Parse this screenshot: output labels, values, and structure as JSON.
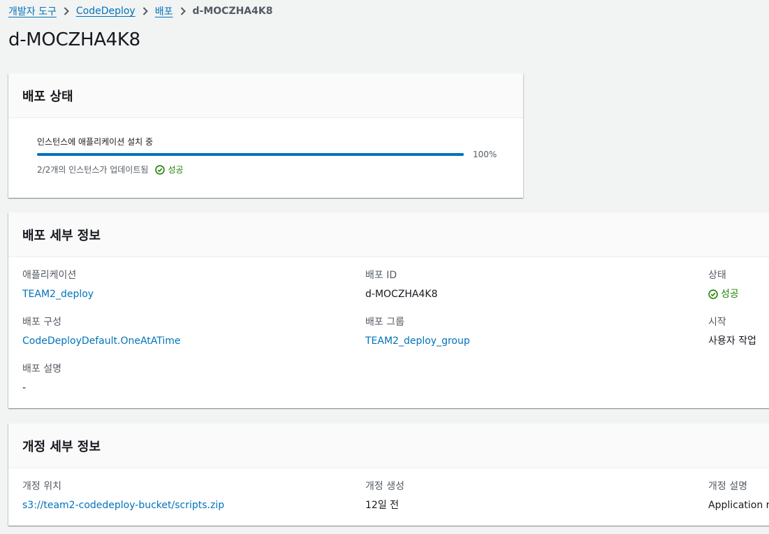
{
  "breadcrumb": {
    "items": [
      "개발자 도구",
      "CodeDeploy",
      "배포"
    ],
    "current": "d-MOCZHA4K8"
  },
  "page_title": "d-MOCZHA4K8",
  "status_panel": {
    "title": "배포 상태",
    "progress_label": "인스턴스에 애플리케이션 설치 중",
    "progress_value": 100,
    "progress_text": "100%",
    "progress_desc": "2/2개의 인스턴스가 업데이트됨",
    "status": "성공"
  },
  "details_panel": {
    "title": "배포 세부 정보",
    "application_label": "애플리케이션",
    "application_value": "TEAM2_deploy",
    "deployment_id_label": "배포 ID",
    "deployment_id_value": "d-MOCZHA4K8",
    "status_label": "상태",
    "status_value": "성공",
    "config_label": "배포 구성",
    "config_value": "CodeDeployDefault.OneAtATime",
    "group_label": "배포 그룹",
    "group_value": "TEAM2_deploy_group",
    "start_label": "시작",
    "start_value": "사용자 작업",
    "description_label": "배포 설명",
    "description_value": "-"
  },
  "revision_panel": {
    "title": "개정 세부 정보",
    "location_label": "개정 위치",
    "location_value": "s3://team2-codedeploy-bucket/scripts.zip",
    "created_label": "개정 생성",
    "created_value": "12일 전",
    "description_label": "개정 설명",
    "description_value": "Application re"
  },
  "colors": {
    "link": "#0073bb",
    "success": "#1d8102",
    "progress": "#0073bb",
    "background": "#f2f3f3"
  },
  "icons": {
    "breadcrumb_separator": "chevron-right-icon",
    "status": "check-circle-icon"
  }
}
